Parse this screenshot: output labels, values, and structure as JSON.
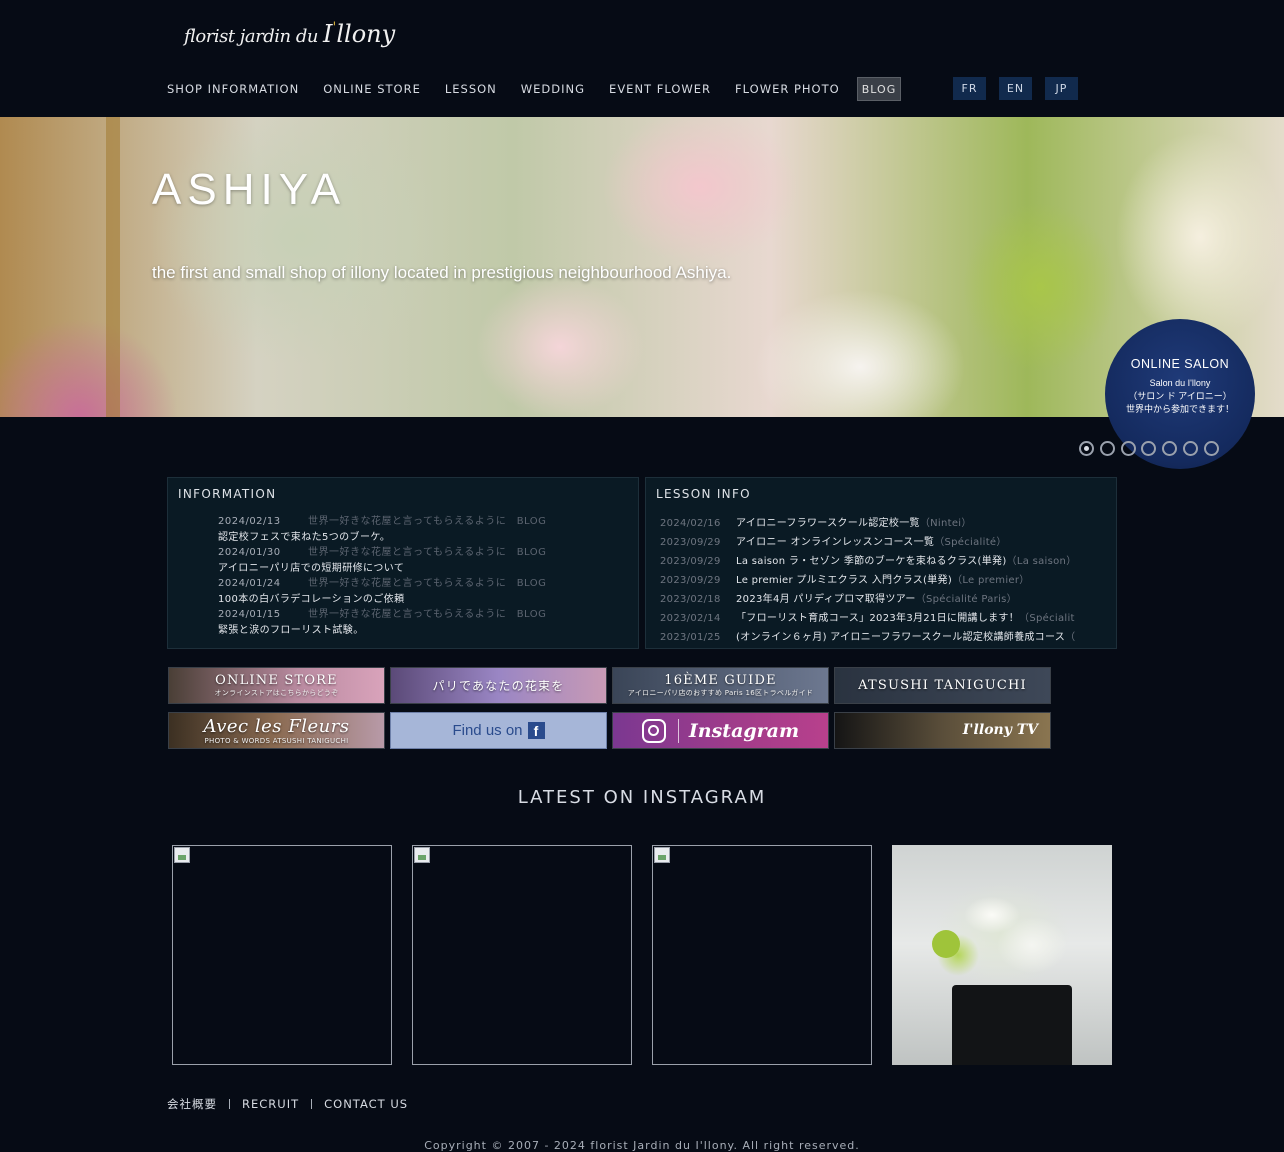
{
  "header": {
    "logo": {
      "small_text": "florist jardin du",
      "big_text": "I",
      "accent": "'",
      "rest": "llony"
    },
    "nav": [
      "SHOP INFORMATION",
      "ONLINE STORE",
      "LESSON",
      "WEDDING",
      "EVENT FLOWER",
      "FLOWER PHOTO"
    ],
    "blog": "BLOG",
    "langs": [
      "FR",
      "EN",
      "JP"
    ]
  },
  "hero": {
    "title": "ASHIYA",
    "subtitle": "the first and small shop of illony located in prestigious neighbourhood Ashiya.",
    "salon": {
      "title": "ONLINE SALON",
      "line1": "Salon du I'llony",
      "line2": "（サロン ド アイロニー）",
      "line3": "世界中から参加できます！"
    },
    "slide_count": 7,
    "active_slide": 1
  },
  "information": {
    "title": "INFORMATION",
    "items": [
      {
        "date": "2024/02/13",
        "category": "世界一好きな花屋と言ってもらえるように　BLOG",
        "title": "認定校フェスで束ねた5つのブーケ。"
      },
      {
        "date": "2024/01/30",
        "category": "世界一好きな花屋と言ってもらえるように　BLOG",
        "title": "アイロニーパリ店での短期研修について"
      },
      {
        "date": "2024/01/24",
        "category": "世界一好きな花屋と言ってもらえるように　BLOG",
        "title": "100本の白バラデコレーションのご依頼"
      },
      {
        "date": "2024/01/15",
        "category": "世界一好きな花屋と言ってもらえるように　BLOG",
        "title": "緊張と涙のフローリスト試験。"
      }
    ]
  },
  "lesson_info": {
    "title": "LESSON INFO",
    "items": [
      {
        "date": "2024/02/16",
        "title": "アイロニーフラワースクール認定校一覧",
        "tag": "（Nintei）"
      },
      {
        "date": "2023/09/29",
        "title": "アイロニー オンラインレッスンコース一覧",
        "tag": "（Spécialité）"
      },
      {
        "date": "2023/09/29",
        "title": "La saison ラ・セゾン 季節のブーケを束ねるクラス(単発)",
        "tag": "（La saison）"
      },
      {
        "date": "2023/09/29",
        "title": "Le premier プルミエクラス 入門クラス(単発)",
        "tag": "（Le premier）"
      },
      {
        "date": "2023/02/18",
        "title": "2023年4月 パリディプロマ取得ツアー",
        "tag": "（Spécialité Paris）"
      },
      {
        "date": "2023/02/14",
        "title": "「フローリスト育成コース」2023年3月21日に開講します！",
        "tag": "（Spécialit"
      },
      {
        "date": "2023/01/25",
        "title": "(オンライン６ヶ月) アイロニーフラワースクール認定校講師養成コース",
        "tag": "（"
      }
    ]
  },
  "banners": {
    "online_store": {
      "main": "ONLINE STORE",
      "sub": "オンラインストアはこちらからどうぞ"
    },
    "paris": {
      "main": "パリであなたの花束を"
    },
    "guide": {
      "main": "16ÈME GUIDE",
      "sub": "アイロニーパリ店のおすすめ Paris 16区トラベルガイド"
    },
    "atsushi": {
      "main": "ATSUSHI TANIGUCHI"
    },
    "avec": {
      "main": "Avec les Fleurs",
      "sub": "PHOTO & WORDS ATSUSHI TANIGUCHI"
    },
    "facebook": {
      "main": "Find us on",
      "icon": "f"
    },
    "instagram": {
      "main": "Instagram"
    },
    "tv": {
      "main": "I'llony TV"
    }
  },
  "instagram": {
    "heading": "LATEST ON INSTAGRAM",
    "tiles": [
      "broken-image",
      "broken-image",
      "broken-image",
      "photo"
    ]
  },
  "footer": {
    "links": [
      "会社概要",
      "RECRUIT",
      "CONTACT US"
    ],
    "copyright": "Copyright © 2007 - 2024 florist Jardin du I'llony. All right reserved."
  },
  "colors": {
    "background": "#060b15",
    "lang_button": "#112a4d",
    "salon_circle": "#1a3470",
    "box_background": "#0a1a24"
  }
}
